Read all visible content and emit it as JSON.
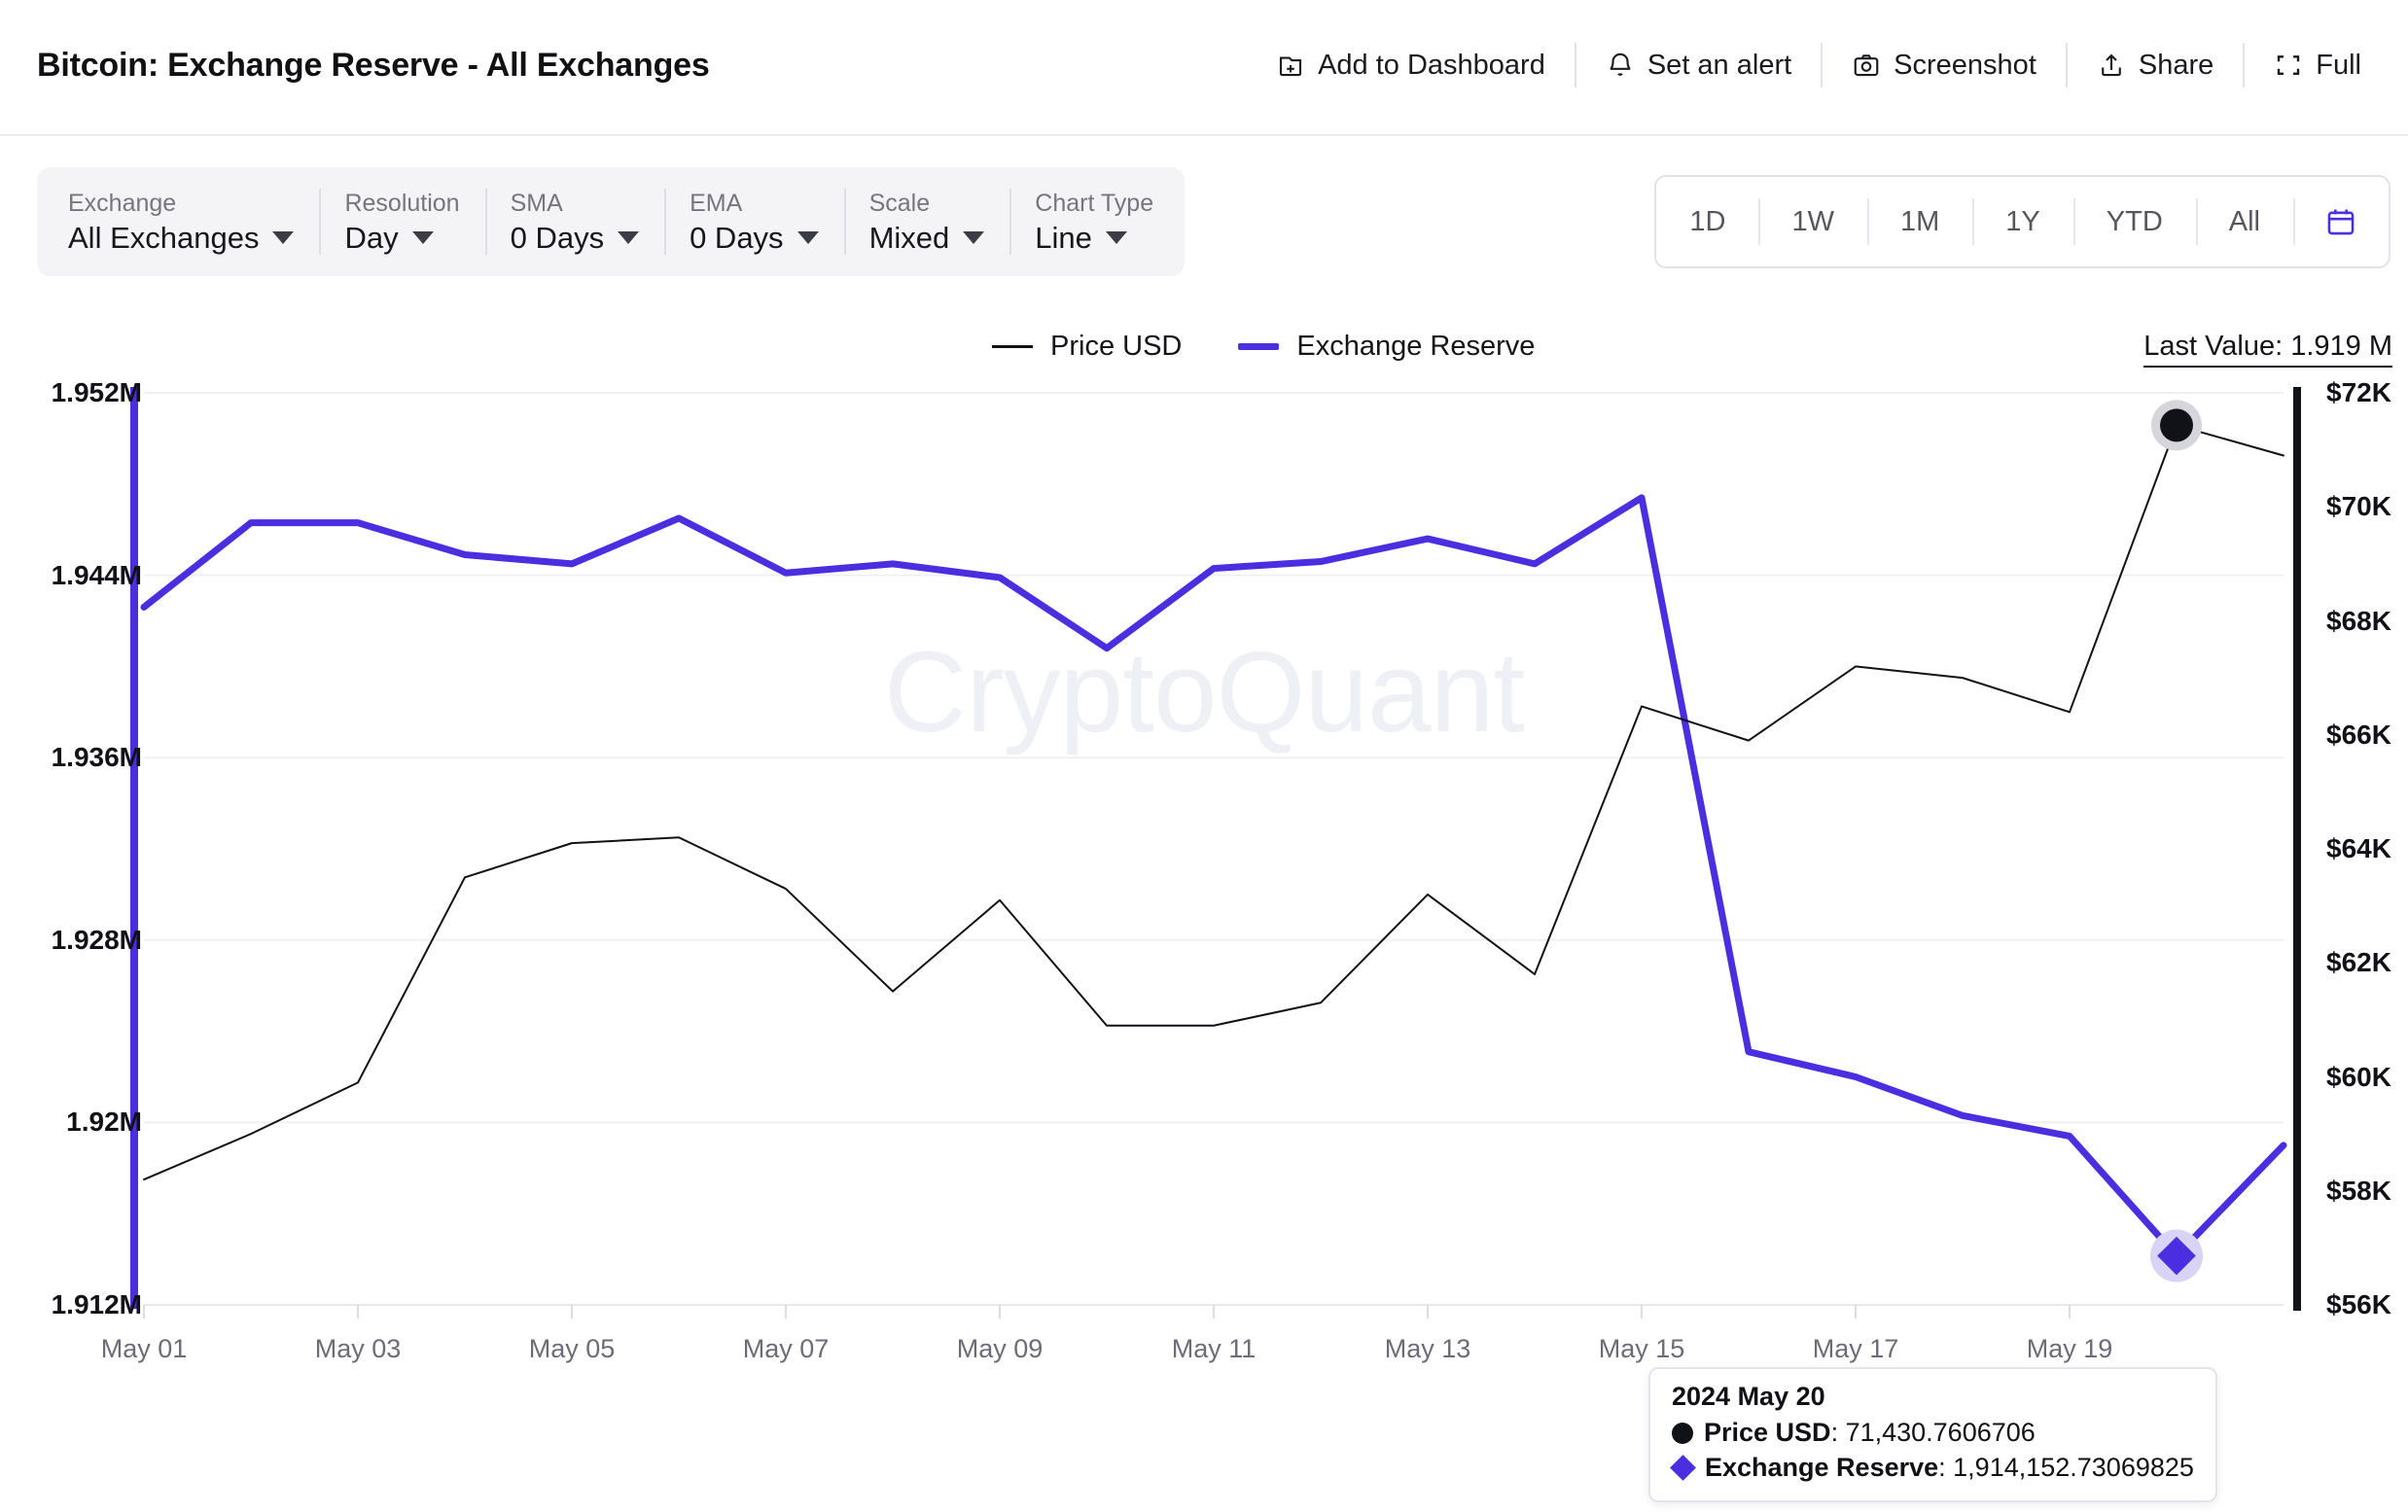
{
  "header": {
    "title": "Bitcoin: Exchange Reserve - All Exchanges",
    "actions": [
      {
        "label": "Add to Dashboard",
        "icon": "add-to-dashboard-icon"
      },
      {
        "label": "Set an alert",
        "icon": "bell-icon"
      },
      {
        "label": "Screenshot",
        "icon": "camera-icon"
      },
      {
        "label": "Share",
        "icon": "share-icon"
      },
      {
        "label": "Full",
        "icon": "fullscreen-icon"
      }
    ]
  },
  "filters": [
    {
      "label": "Exchange",
      "value": "All Exchanges"
    },
    {
      "label": "Resolution",
      "value": "Day"
    },
    {
      "label": "SMA",
      "value": "0 Days"
    },
    {
      "label": "EMA",
      "value": "0 Days"
    },
    {
      "label": "Scale",
      "value": "Mixed"
    },
    {
      "label": "Chart Type",
      "value": "Line"
    }
  ],
  "range_selector": {
    "options": [
      "1D",
      "1W",
      "1M",
      "1Y",
      "YTD",
      "All"
    ],
    "calendar_icon": "calendar-icon"
  },
  "legend": {
    "items": [
      {
        "label": "Price USD",
        "color": "#111118"
      },
      {
        "label": "Exchange Reserve",
        "color": "#4a2ee0"
      }
    ]
  },
  "last_value": "Last Value: 1.919 M",
  "watermark": "CryptoQuant",
  "tooltip": {
    "date": "2024 May 20",
    "rows": [
      {
        "marker": "circle",
        "key": "Price USD",
        "value": "71,430.7606706"
      },
      {
        "marker": "diamond",
        "key": "Exchange Reserve",
        "value": "1,914,152.73069825"
      }
    ]
  },
  "chart_data": {
    "type": "line",
    "title": "Bitcoin: Exchange Reserve - All Exchanges",
    "xlabel": "",
    "grid": true,
    "legend_position": "top-center",
    "x": [
      "May 01",
      "May 02",
      "May 03",
      "May 04",
      "May 05",
      "May 06",
      "May 07",
      "May 08",
      "May 09",
      "May 10",
      "May 11",
      "May 12",
      "May 13",
      "May 14",
      "May 15",
      "May 16",
      "May 17",
      "May 18",
      "May 19",
      "May 20",
      "May 21"
    ],
    "x_tick_labels": [
      "May 01",
      "May 03",
      "May 05",
      "May 07",
      "May 09",
      "May 11",
      "May 13",
      "May 15",
      "May 17",
      "May 19"
    ],
    "axes": [
      {
        "id": "left",
        "name": "Exchange Reserve",
        "ylim": [
          1912000,
          1952000
        ],
        "ticks": [
          1952000,
          1944000,
          1936000,
          1928000,
          1920000,
          1912000
        ],
        "tick_labels": [
          "1.952M",
          "1.944M",
          "1.936M",
          "1.928M",
          "1.92M",
          "1.912M"
        ]
      },
      {
        "id": "right",
        "name": "Price USD",
        "ylim": [
          56000,
          72000
        ],
        "ticks": [
          72000,
          70000,
          68000,
          66000,
          64000,
          62000,
          60000,
          58000,
          56000
        ],
        "tick_labels": [
          "$72K",
          "$70K",
          "$68K",
          "$66K",
          "$64K",
          "$62K",
          "$60K",
          "$58K",
          "$56K"
        ]
      }
    ],
    "series": [
      {
        "name": "Exchange Reserve",
        "axis": "left",
        "color": "#4a2ee0",
        "width": 7,
        "unit": "BTC",
        "values": [
          1942600,
          1946300,
          1946300,
          1944900,
          1944500,
          1946500,
          1944100,
          1944500,
          1943900,
          1940800,
          1944300,
          1944600,
          1945600,
          1944500,
          1947400,
          1923100,
          1922000,
          1920300,
          1919400,
          1914152.73,
          1919000
        ]
      },
      {
        "name": "Price USD",
        "axis": "right",
        "color": "#111118",
        "width": 2,
        "unit": "USD",
        "values": [
          58200,
          59000,
          59900,
          63500,
          64100,
          64200,
          63300,
          61500,
          63100,
          60900,
          60900,
          61300,
          63200,
          61800,
          66500,
          65900,
          67200,
          67000,
          66400,
          71430.76,
          70900
        ]
      }
    ],
    "highlight_point": {
      "x": "May 20",
      "price_usd": 71430.7606706,
      "exchange_reserve": 1914152.73069825
    }
  }
}
